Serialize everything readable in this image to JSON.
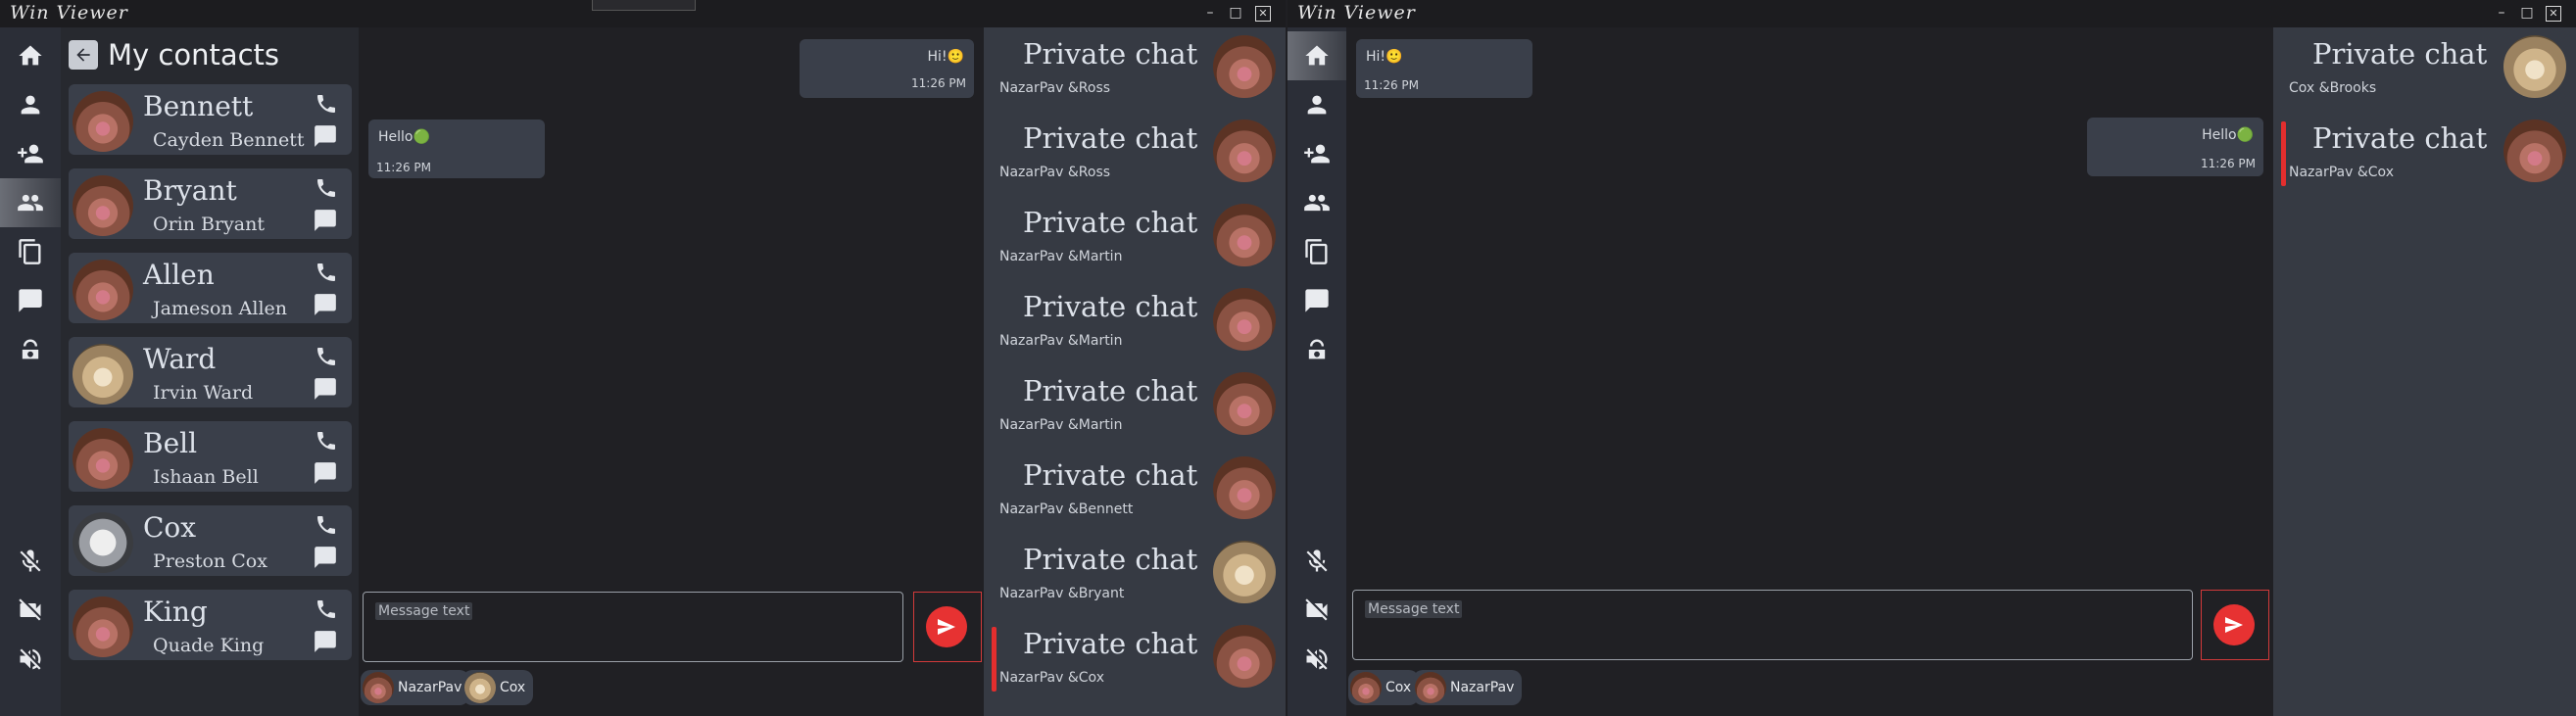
{
  "window1": {
    "title": "Win Viewer",
    "contacts_header": "My contacts",
    "contacts": [
      {
        "name": "Bennett",
        "full": "Cayden Bennett",
        "avatar": "hamster"
      },
      {
        "name": "Bryant",
        "full": "Orin Bryant",
        "avatar": "hamster"
      },
      {
        "name": "Allen",
        "full": "Jameson Allen",
        "avatar": "hamster"
      },
      {
        "name": "Ward",
        "full": "Irvin Ward",
        "avatar": "cat"
      },
      {
        "name": "Bell",
        "full": "Ishaan Bell",
        "avatar": "hamster"
      },
      {
        "name": "Cox",
        "full": "Preston Cox",
        "avatar": "kitten"
      },
      {
        "name": "King",
        "full": "Quade King",
        "avatar": "hamster"
      }
    ],
    "messages": [
      {
        "text": "Hi!🙂",
        "time": "11:26 PM",
        "side": "right"
      },
      {
        "text": "Hello🟢",
        "time": "11:26 PM",
        "side": "left"
      }
    ],
    "input_placeholder": "Message text",
    "participants": [
      "NazarPav",
      "Cox"
    ],
    "chats": [
      {
        "title": "Private chat",
        "sub": "NazarPav &Ross"
      },
      {
        "title": "Private chat",
        "sub": "NazarPav &Ross"
      },
      {
        "title": "Private chat",
        "sub": "NazarPav &Martin"
      },
      {
        "title": "Private chat",
        "sub": "NazarPav &Martin"
      },
      {
        "title": "Private chat",
        "sub": "NazarPav &Martin"
      },
      {
        "title": "Private chat",
        "sub": "NazarPav &Bennett"
      },
      {
        "title": "Private chat",
        "sub": "NazarPav &Bryant"
      },
      {
        "title": "Private chat",
        "sub": "NazarPav &Cox"
      }
    ]
  },
  "window2": {
    "title": "Win Viewer",
    "messages": [
      {
        "text": "Hi!🙂",
        "time": "11:26 PM",
        "side": "left"
      },
      {
        "text": "Hello🟢",
        "time": "11:26 PM",
        "side": "right"
      }
    ],
    "input_placeholder": "Message text",
    "participants": [
      "Cox",
      "NazarPav"
    ],
    "chats": [
      {
        "title": "Private chat",
        "sub": "Cox &Brooks"
      },
      {
        "title": "Private chat",
        "sub": "NazarPav &Cox"
      }
    ]
  },
  "colors": {
    "accent": "#e73232",
    "card": "#3a3f4a",
    "rail": "#2b2e37"
  },
  "icons": [
    "home-icon",
    "person-icon",
    "add-person-icon",
    "group-icon",
    "copy-icon",
    "chat-icon",
    "camera-icon",
    "mic-off-icon",
    "video-off-icon",
    "volume-off-icon",
    "phone-icon",
    "message-icon",
    "back-icon",
    "send-icon"
  ]
}
